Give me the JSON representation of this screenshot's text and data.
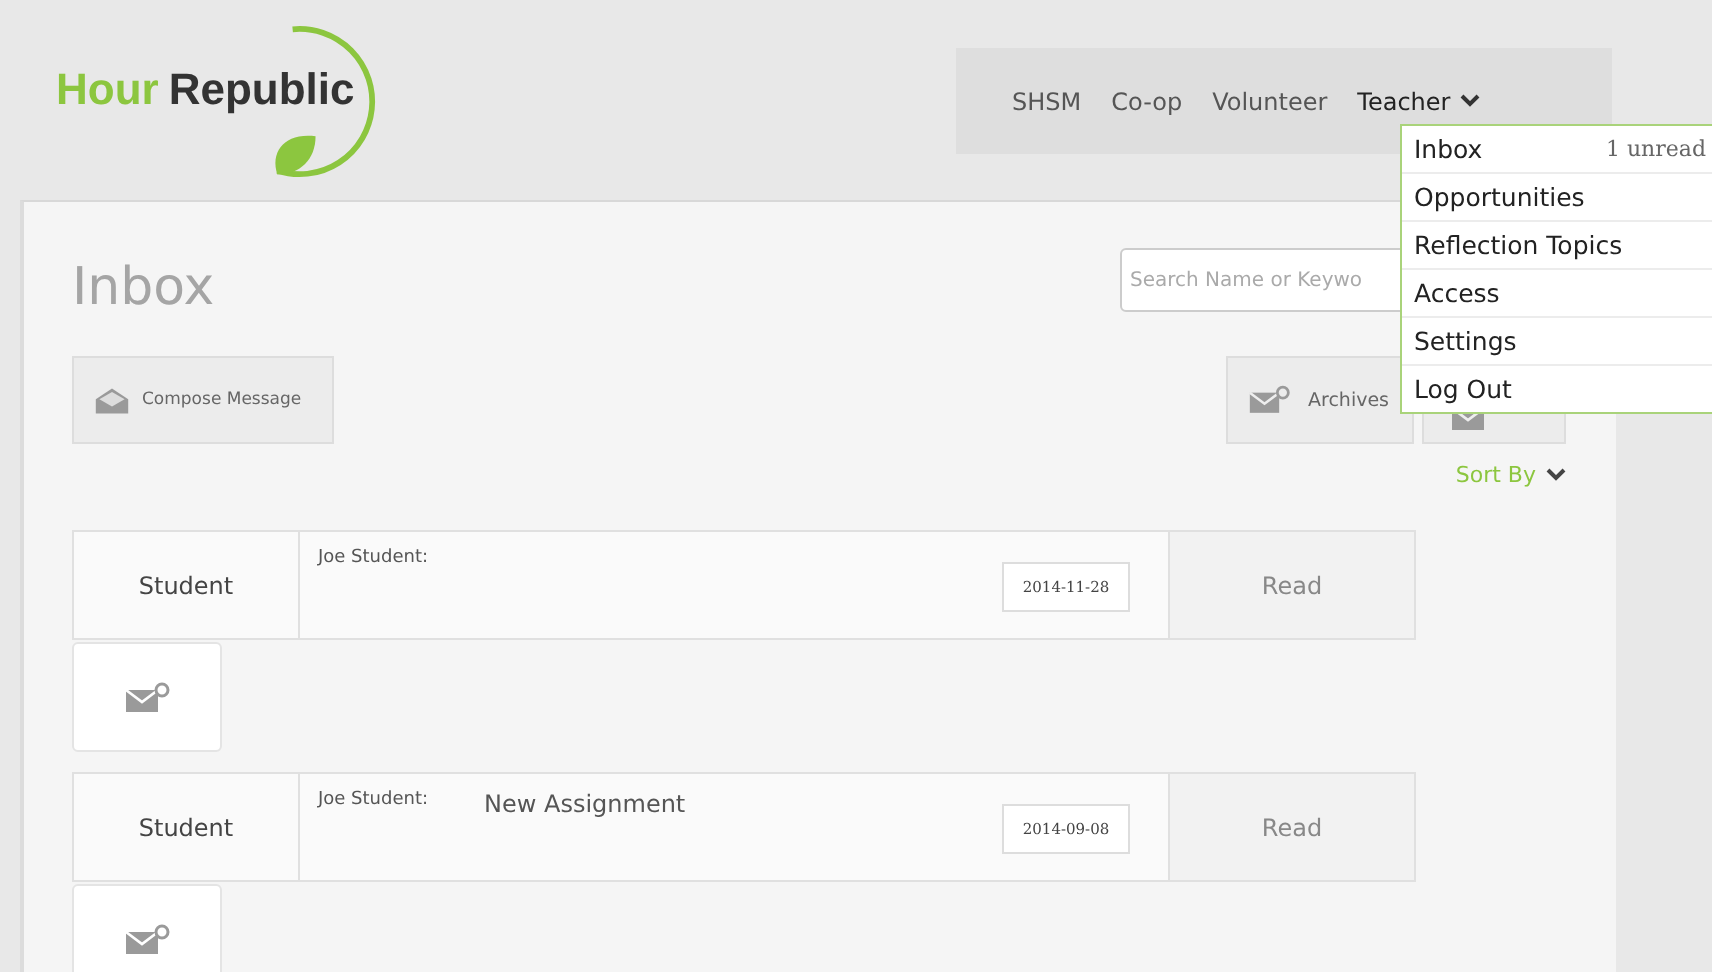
{
  "logo": {
    "words": [
      "Hour",
      "Republic"
    ]
  },
  "nav": {
    "items": [
      {
        "label": "SHSM",
        "kind": "link"
      },
      {
        "label": "Co-op",
        "kind": "link"
      },
      {
        "label": "Volunteer",
        "kind": "link"
      },
      {
        "label": "Teacher",
        "kind": "dropdown",
        "expanded": true
      }
    ]
  },
  "menu": {
    "items": [
      {
        "label": "Inbox",
        "badge": "1 unread"
      },
      {
        "label": "Opportunities"
      },
      {
        "label": "Reflection Topics"
      },
      {
        "label": "Access"
      },
      {
        "label": "Settings"
      },
      {
        "label": "Log Out"
      }
    ]
  },
  "page": {
    "title": "Inbox",
    "search": {
      "placeholder": "Search Name or Keywo"
    }
  },
  "buttons": {
    "compose": "Compose Message",
    "archives": "Archives",
    "sort": "Sort By"
  },
  "messages": [
    {
      "sender_type": "Student",
      "from": "Joe Student:",
      "date": "2014-11-28",
      "status": "Read"
    },
    {
      "sender_type": "Student",
      "from": "Joe Student:",
      "subject": "New Assignment",
      "date": "2014-09-08",
      "status": "Read"
    }
  ]
}
